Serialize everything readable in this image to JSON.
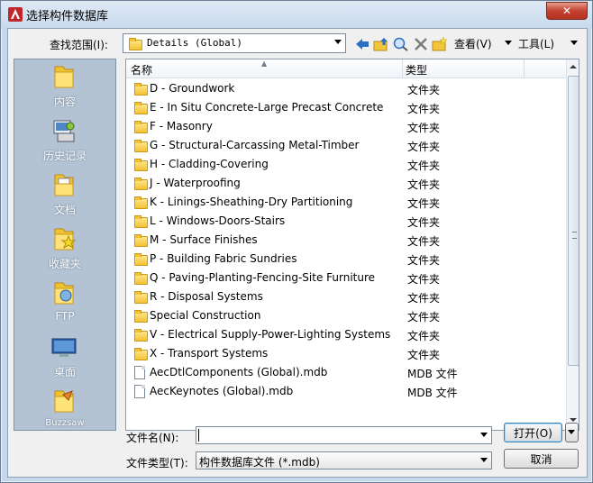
{
  "window": {
    "title": "选择构件数据库",
    "close_glyph": "✕"
  },
  "toolbar": {
    "lookin_label": "查找范围(I):",
    "lookin_value": "Details (Global)",
    "icons": [
      "back-icon",
      "up-folder-icon",
      "search-web-icon",
      "delete-icon",
      "new-folder-icon"
    ],
    "view_label": "查看(V)",
    "tools_label": "工具(L)"
  },
  "places": [
    {
      "label": "内容",
      "icon": "folder-content-icon"
    },
    {
      "label": "历史记录",
      "icon": "history-icon"
    },
    {
      "label": "文档",
      "icon": "documents-icon"
    },
    {
      "label": "收藏夹",
      "icon": "favorites-icon"
    },
    {
      "label": "FTP",
      "icon": "ftp-icon"
    },
    {
      "label": "桌面",
      "icon": "desktop-icon"
    },
    {
      "label": "Buzzsaw",
      "icon": "buzzsaw-icon"
    }
  ],
  "list": {
    "columns": [
      "名称",
      "类型"
    ],
    "rows": [
      {
        "name": "D - Groundwork",
        "type": "文件夹",
        "kind": "folder"
      },
      {
        "name": "E - In Situ Concrete-Large Precast Concrete",
        "type": "文件夹",
        "kind": "folder"
      },
      {
        "name": "F - Masonry",
        "type": "文件夹",
        "kind": "folder"
      },
      {
        "name": "G - Structural-Carcassing Metal-Timber",
        "type": "文件夹",
        "kind": "folder"
      },
      {
        "name": "H - Cladding-Covering",
        "type": "文件夹",
        "kind": "folder"
      },
      {
        "name": "J - Waterproofing",
        "type": "文件夹",
        "kind": "folder"
      },
      {
        "name": "K - Linings-Sheathing-Dry Partitioning",
        "type": "文件夹",
        "kind": "folder"
      },
      {
        "name": "L - Windows-Doors-Stairs",
        "type": "文件夹",
        "kind": "folder"
      },
      {
        "name": "M - Surface Finishes",
        "type": "文件夹",
        "kind": "folder"
      },
      {
        "name": "P - Building Fabric Sundries",
        "type": "文件夹",
        "kind": "folder"
      },
      {
        "name": "Q - Paving-Planting-Fencing-Site Furniture",
        "type": "文件夹",
        "kind": "folder"
      },
      {
        "name": "R - Disposal Systems",
        "type": "文件夹",
        "kind": "folder"
      },
      {
        "name": "Special Construction",
        "type": "文件夹",
        "kind": "folder"
      },
      {
        "name": "V - Electrical Supply-Power-Lighting Systems",
        "type": "文件夹",
        "kind": "folder"
      },
      {
        "name": "X - Transport Systems",
        "type": "文件夹",
        "kind": "folder"
      },
      {
        "name": "AecDtlComponents (Global).mdb",
        "type": "MDB 文件",
        "kind": "file"
      },
      {
        "name": "AecKeynotes (Global).mdb",
        "type": "MDB 文件",
        "kind": "file"
      }
    ]
  },
  "bottom": {
    "filename_label": "文件名(N):",
    "filename_value": "",
    "filetype_label": "文件类型(T):",
    "filetype_value": "构件数据库文件 (*.mdb)",
    "open_label": "打开(O)",
    "cancel_label": "取消"
  }
}
